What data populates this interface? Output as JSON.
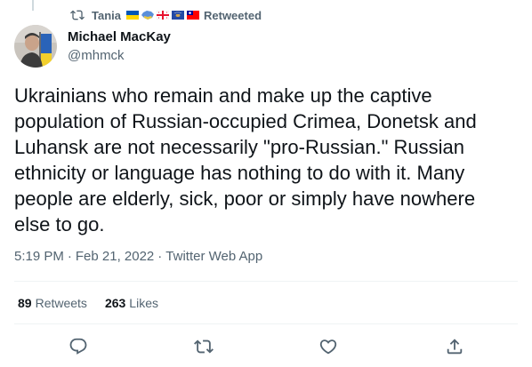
{
  "social_context": {
    "retweeter_name": "Tania",
    "retweeted_label": "Retweeted",
    "flags": [
      "ukraine-flag",
      "ukraine-map-flag",
      "georgia-flag",
      "kosovo-flag",
      "taiwan-flag"
    ]
  },
  "author": {
    "name": "Michael MacKay",
    "handle": "@mhmck",
    "avatar": "avatar-photo"
  },
  "tweet": {
    "text": "Ukrainians who remain and make up the captive\npopulation of Russian-occupied Crimea, Donetsk and\nLuhansk are not necessarily \"pro-Russian.\" Russian\nethnicity or language has nothing to do with it. Many\npeople are elderly, sick, poor or simply have nowhere\nelse to go."
  },
  "meta": {
    "time": "5:19 PM",
    "separator": "·",
    "date": "Feb 21, 2022",
    "source": "Twitter Web App"
  },
  "stats": {
    "retweets_count": "89",
    "retweets_label": "Retweets",
    "likes_count": "263",
    "likes_label": "Likes"
  },
  "actions": [
    "reply-icon",
    "retweet-icon",
    "like-icon",
    "share-icon"
  ],
  "colors": {
    "text_primary": "#0f1419",
    "text_secondary": "#536471",
    "divider": "#eff3f4"
  }
}
